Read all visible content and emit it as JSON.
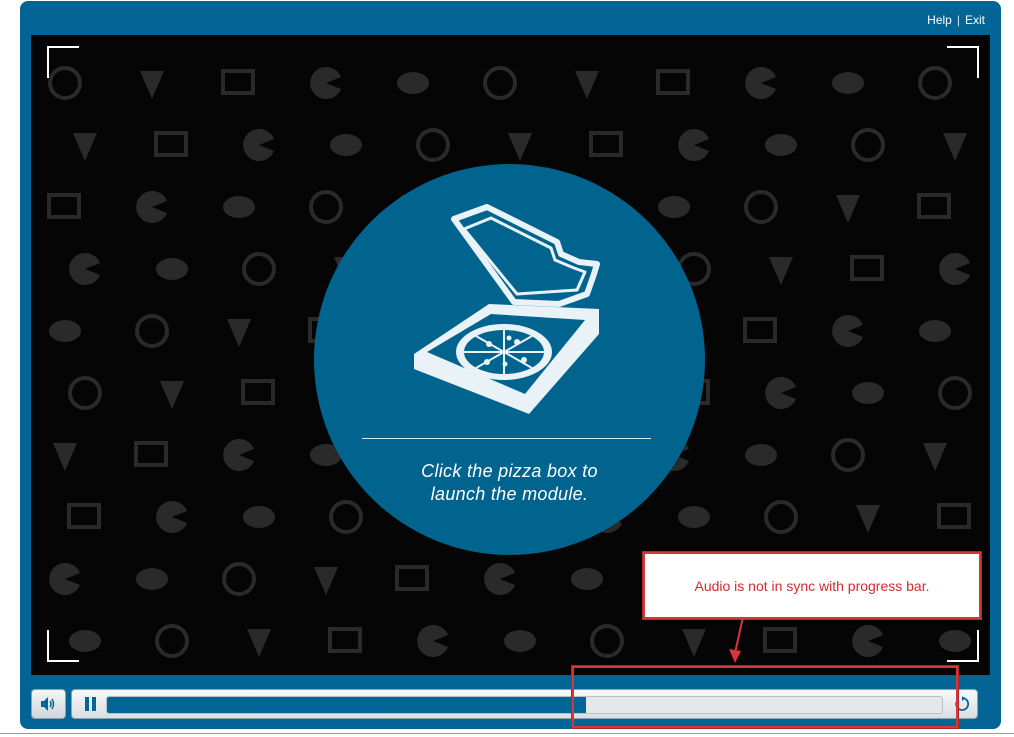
{
  "header": {
    "help_label": "Help",
    "separator": "|",
    "exit_label": "Exit"
  },
  "stage": {
    "launch_text_line1": "Click the pizza box to",
    "launch_text_line2": "launch the module.",
    "pizza_icon": "pizza-box-icon",
    "background_pattern": "pizza-icons-pattern"
  },
  "player": {
    "volume_icon": "speaker-icon",
    "pause_icon": "pause-icon",
    "replay_icon": "replay-icon",
    "progress": 0.574
  },
  "annotation": {
    "text": "Audio is not in sync with progress bar."
  },
  "colors": {
    "frame": "#036595",
    "accent": "#00648f",
    "annotation": "#d5363c"
  }
}
